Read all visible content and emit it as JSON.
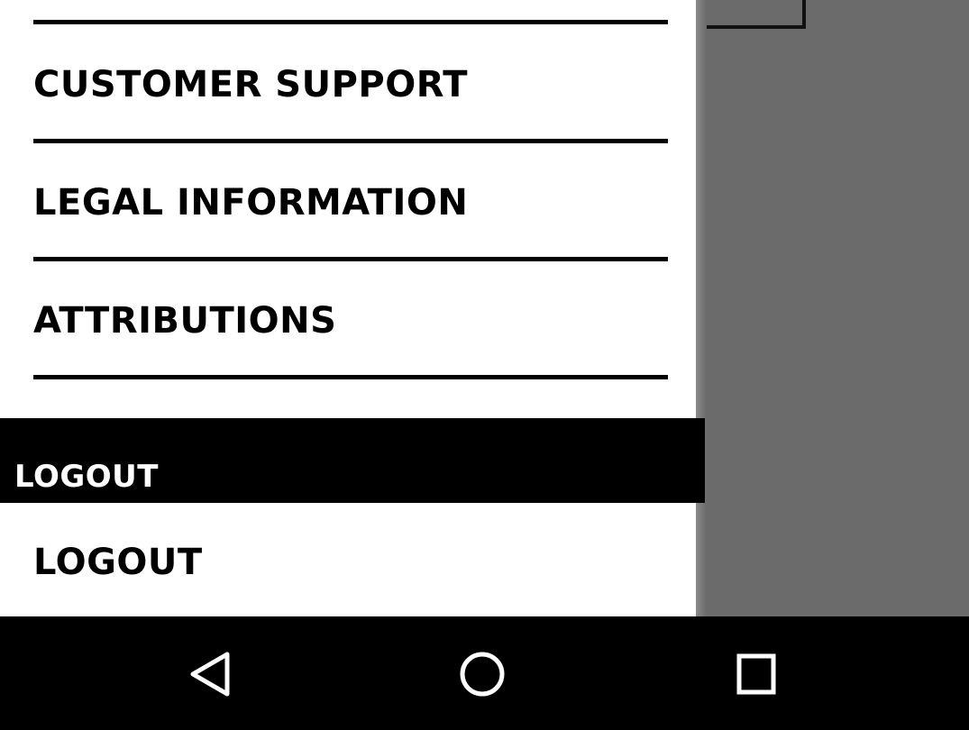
{
  "drawer": {
    "items": [
      {
        "label": "CUSTOMER SUPPORT"
      },
      {
        "label": "LEGAL INFORMATION"
      },
      {
        "label": "ATTRIBUTIONS"
      }
    ],
    "section_header": "LOGOUT",
    "logout_label": "LOGOUT"
  },
  "navbar": {
    "back_icon": "back-triangle-icon",
    "home_icon": "home-circle-icon",
    "recents_icon": "recents-square-icon"
  },
  "colors": {
    "drawer_bg": "#ffffff",
    "scrim": "#6b6b6b",
    "header_bg": "#000000",
    "navbar_bg": "#000000",
    "text": "#000000"
  }
}
